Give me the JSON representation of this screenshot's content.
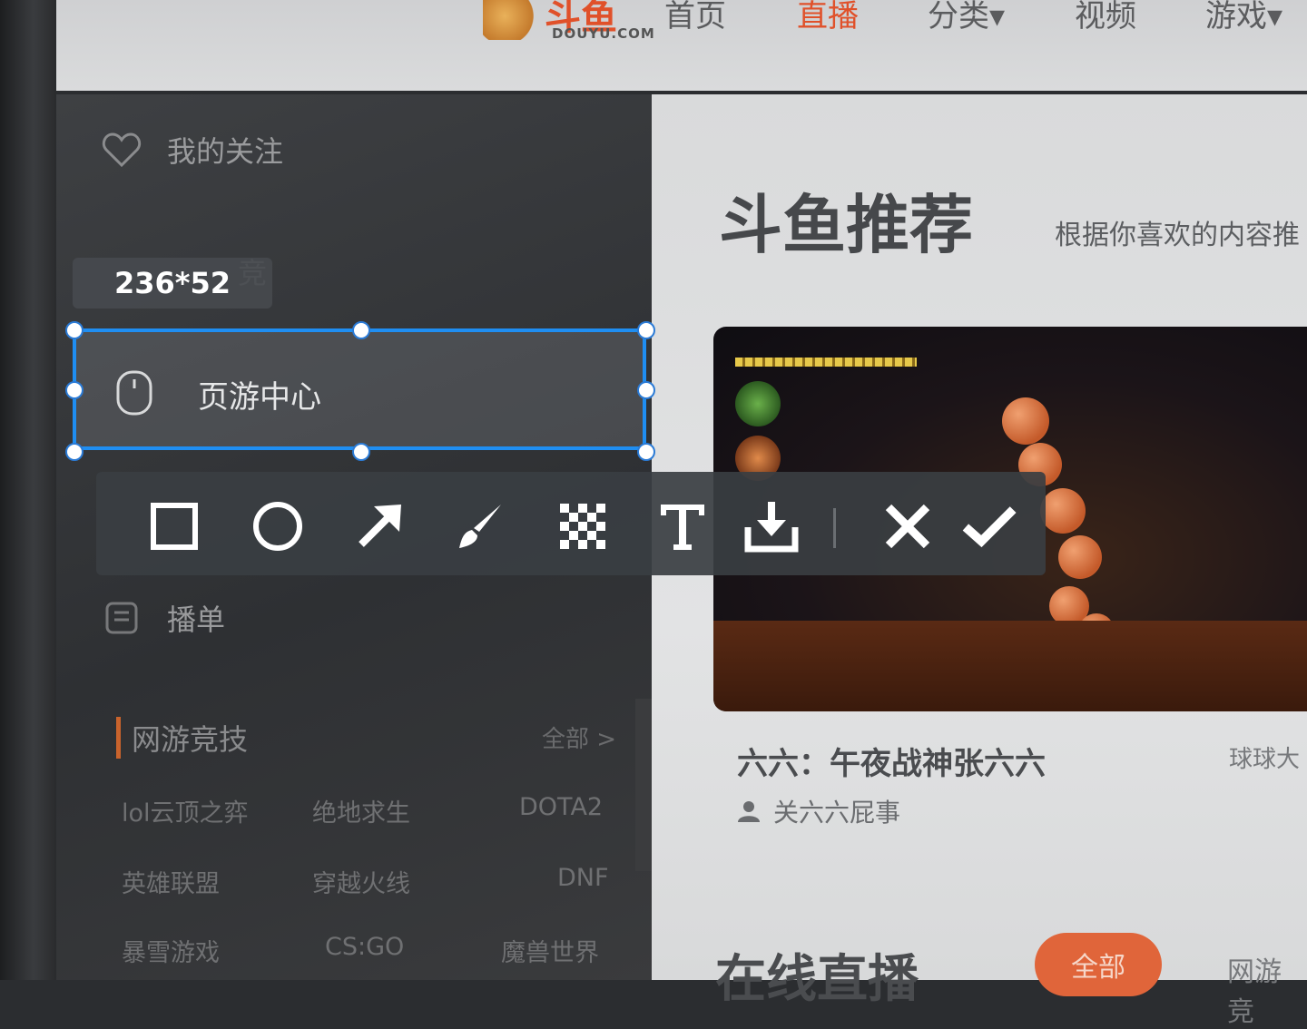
{
  "topnav": {
    "logo_text": "斗鱼",
    "logo_sub": "DOUYU.COM",
    "items": [
      {
        "label": "首页"
      },
      {
        "label": "直播"
      },
      {
        "label": "分类▾"
      },
      {
        "label": "视频"
      },
      {
        "label": "游戏▾"
      }
    ],
    "active_color": "#e0512a"
  },
  "sidebar": {
    "follow_label": "我的关注",
    "partial_label": "竞",
    "list_label": "播单",
    "category_title": "网游竞技",
    "category_more": "全部 >",
    "categories": [
      "lol云顶之弈",
      "绝地求生",
      "DOTA2",
      "英雄联盟",
      "穿越火线",
      "DNF",
      "暴雪游戏",
      "CS:GO",
      "魔兽世界"
    ],
    "collapse_icon": "chevron-left-icon"
  },
  "main": {
    "rec_title": "斗鱼推荐",
    "rec_sub": "根据你喜欢的内容推",
    "stream_title": "六六：午夜战神张六六",
    "stream_side": "球球大",
    "stream_owner": "关六六屁事",
    "live_title": "在线直播",
    "btn_all": "全部",
    "btn_game": "网游竞"
  },
  "screenshot_tool": {
    "size_label": "236*52",
    "selection_label": "页游中心",
    "selection_color": "#1f8ef2",
    "tools": [
      "rectangle-icon",
      "ellipse-icon",
      "arrow-icon",
      "brush-icon",
      "mosaic-icon",
      "text-icon",
      "save-icon",
      "cancel-icon",
      "confirm-icon"
    ]
  }
}
